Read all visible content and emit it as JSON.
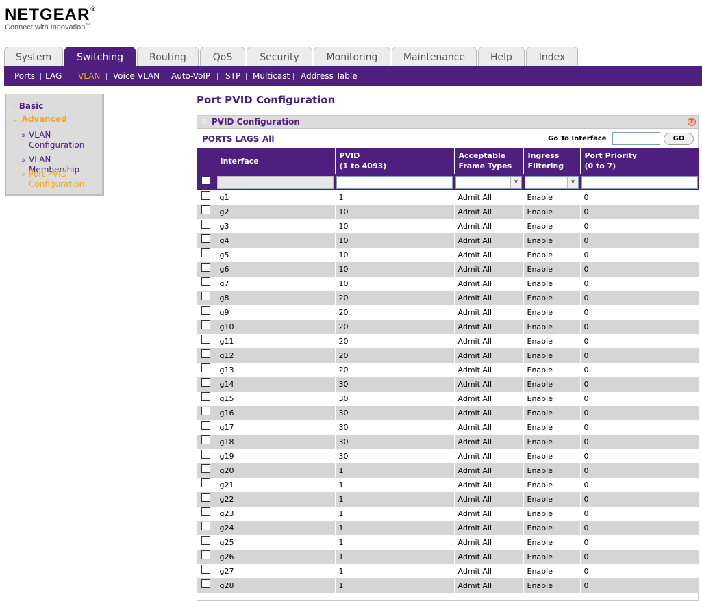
{
  "brand": {
    "name": "NETGEAR",
    "reg": "®",
    "tagline": "Connect with Innovation",
    "tm": "™"
  },
  "tabs": [
    "System",
    "Switching",
    "Routing",
    "QoS",
    "Security",
    "Monitoring",
    "Maintenance",
    "Help",
    "Index"
  ],
  "active_tab": "Switching",
  "subnav": [
    "Ports",
    "LAG",
    "VLAN",
    "Voice VLAN",
    "Auto-VoIP",
    "STP",
    "Multicast",
    "Address Table"
  ],
  "active_subnav": "VLAN",
  "sidebar": {
    "basic": "Basic",
    "advanced": "Advanced",
    "items": [
      {
        "bullet": "»",
        "label": "VLAN Configuration"
      },
      {
        "bullet": "»",
        "label": "VLAN Membership"
      },
      {
        "bullet": "»",
        "label": "Port PVID Configuration"
      }
    ]
  },
  "page_title": "Port PVID Configuration",
  "panel": {
    "title": "PVID Configuration",
    "help": "?"
  },
  "filters": {
    "ports": "PORTS",
    "lags": "LAGS",
    "all": "All"
  },
  "goto": {
    "label": "Go To Interface",
    "button": "GO",
    "value": ""
  },
  "table": {
    "headers": {
      "interface": "Interface",
      "pvid": "PVID",
      "pvid_range": "(1 to 4093)",
      "aft": "Acceptable",
      "aft2": "Frame Types",
      "ingress": "Ingress",
      "ingress2": "Filtering",
      "priority": "Port Priority",
      "priority_range": "(0 to 7)"
    },
    "rows": [
      [
        "g1",
        "1",
        "Admit All",
        "Enable",
        "0"
      ],
      [
        "g2",
        "10",
        "Admit All",
        "Enable",
        "0"
      ],
      [
        "g3",
        "10",
        "Admit All",
        "Enable",
        "0"
      ],
      [
        "g4",
        "10",
        "Admit All",
        "Enable",
        "0"
      ],
      [
        "g5",
        "10",
        "Admit All",
        "Enable",
        "0"
      ],
      [
        "g6",
        "10",
        "Admit All",
        "Enable",
        "0"
      ],
      [
        "g7",
        "10",
        "Admit All",
        "Enable",
        "0"
      ],
      [
        "g8",
        "20",
        "Admit All",
        "Enable",
        "0"
      ],
      [
        "g9",
        "20",
        "Admit All",
        "Enable",
        "0"
      ],
      [
        "g10",
        "20",
        "Admit All",
        "Enable",
        "0"
      ],
      [
        "g11",
        "20",
        "Admit All",
        "Enable",
        "0"
      ],
      [
        "g12",
        "20",
        "Admit All",
        "Enable",
        "0"
      ],
      [
        "g13",
        "20",
        "Admit All",
        "Enable",
        "0"
      ],
      [
        "g14",
        "30",
        "Admit All",
        "Enable",
        "0"
      ],
      [
        "g15",
        "30",
        "Admit All",
        "Enable",
        "0"
      ],
      [
        "g16",
        "30",
        "Admit All",
        "Enable",
        "0"
      ],
      [
        "g17",
        "30",
        "Admit All",
        "Enable",
        "0"
      ],
      [
        "g18",
        "30",
        "Admit All",
        "Enable",
        "0"
      ],
      [
        "g19",
        "30",
        "Admit All",
        "Enable",
        "0"
      ],
      [
        "g20",
        "1",
        "Admit All",
        "Enable",
        "0"
      ],
      [
        "g21",
        "1",
        "Admit All",
        "Enable",
        "0"
      ],
      [
        "g22",
        "1",
        "Admit All",
        "Enable",
        "0"
      ],
      [
        "g23",
        "1",
        "Admit All",
        "Enable",
        "0"
      ],
      [
        "g24",
        "1",
        "Admit All",
        "Enable",
        "0"
      ],
      [
        "g25",
        "1",
        "Admit All",
        "Enable",
        "0"
      ],
      [
        "g26",
        "1",
        "Admit All",
        "Enable",
        "0"
      ],
      [
        "g27",
        "1",
        "Admit All",
        "Enable",
        "0"
      ],
      [
        "g28",
        "1",
        "Admit All",
        "Enable",
        "0"
      ]
    ]
  },
  "colors": {
    "brand_purple": "#4e1f7f",
    "accent_orange": "#f7a51c",
    "row_alt": "#d5d5d5"
  }
}
